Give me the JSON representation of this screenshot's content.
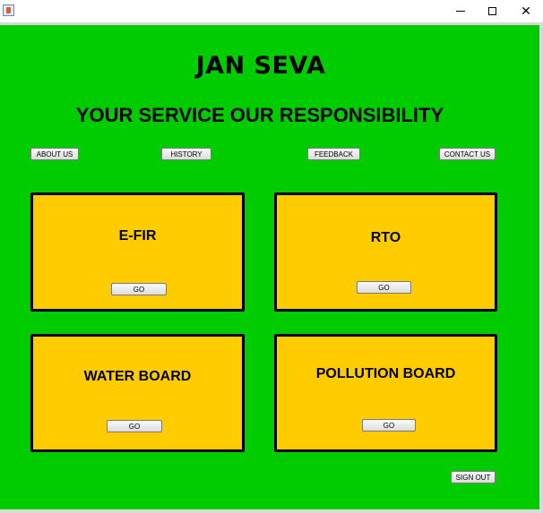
{
  "window": {
    "minimize_symbol": "",
    "close_symbol": "✕"
  },
  "header": {
    "title": "JAN SEVA",
    "tagline": "YOUR SERVICE OUR RESPONSIBILITY"
  },
  "nav": {
    "about": "ABOUT US",
    "history": "HISTORY",
    "feedback": "FEEDBACK",
    "contact": "CONTACT US"
  },
  "services": {
    "efir": {
      "title": "E-FIR",
      "go": "GO"
    },
    "rto": {
      "title": "RTO",
      "go": "GO"
    },
    "water": {
      "title": "WATER BOARD",
      "go": "GO"
    },
    "pollution": {
      "title": "POLLUTION BOARD",
      "go": "GO"
    }
  },
  "footer": {
    "sign_out": "SIGN OUT"
  },
  "colors": {
    "background": "#00cc00",
    "card": "#ffcc00",
    "card_border": "#000000"
  }
}
